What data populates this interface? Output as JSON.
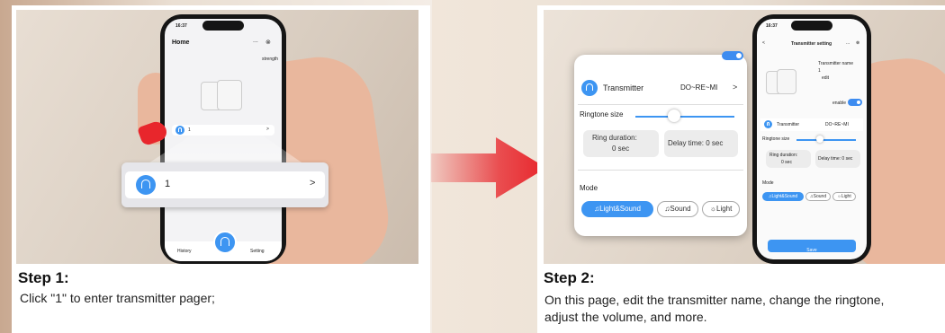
{
  "step1": {
    "title": "Step  1:",
    "description": "Click \"1\" to enter transmitter pager;",
    "phone": {
      "time": "16:37",
      "header": "Home",
      "more": "...",
      "close": "⊗",
      "strength": "strength",
      "list_item": "1",
      "nav_history": "History",
      "nav_setting": "Setting"
    },
    "zoom_item_label": "1",
    "zoom_chevron": ">"
  },
  "step2": {
    "title": "Step 2:",
    "description_line1": "On this page, edit the transmitter name, change the ringtone,",
    "description_line2": "adjust the volume, and more.",
    "phone": {
      "time": "16:37",
      "back": "<",
      "header": "Transmitter setting",
      "more": "...",
      "close": "⊗",
      "name_label": "Transmitter name",
      "name_value": "1",
      "edit": "edit",
      "enable": "enable",
      "transmitter_label": "Transmitter",
      "transmitter_value": "DO~RE~MI",
      "ringtone_size": "Ringtone size",
      "ring_duration": "Ring duration:",
      "ring_duration_value": "0 sec",
      "delay_time": "Delay time:  0 sec",
      "mode": "Mode",
      "mode_options": [
        "♫Light&Sound",
        "♫Sound",
        "☼Light"
      ],
      "save": "Save"
    },
    "zoom": {
      "transmitter_label": "Transmitter",
      "transmitter_value": "DO~RE~MI",
      "chevron": ">",
      "ringtone_size": "Ringtone size",
      "ring_duration": "Ring duration:",
      "ring_duration_value": "0 sec",
      "delay_time": "Delay time:   0 sec",
      "mode": "Mode",
      "mode_options": [
        "♫Light&Sound",
        "♫Sound",
        "☼Light"
      ]
    }
  },
  "colors": {
    "accent": "#3d95f2",
    "arrow": "#e8262c"
  }
}
